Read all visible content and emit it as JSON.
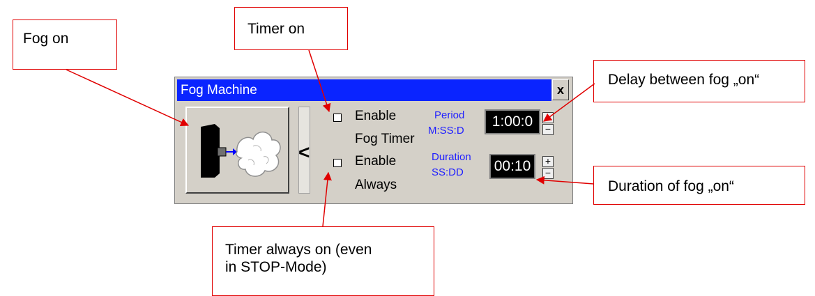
{
  "callouts": {
    "fog_on": "Fog on",
    "timer_on": "Timer on",
    "delay": "Delay between fog „on“",
    "duration": "Duration of fog „on“",
    "always_line1": "Timer always on (even",
    "always_line2": "in STOP-Mode)"
  },
  "window": {
    "title": "Fog Machine",
    "close_label": "x",
    "collapse_label": "<",
    "enable_fog_timer_line1": "Enable",
    "enable_fog_timer_line2": "Fog Timer",
    "enable_always_line1": "Enable",
    "enable_always_line2": "Always",
    "period_label": "Period",
    "period_format": "M:SS:D",
    "period_value": "1:00:0",
    "duration_label": "Duration",
    "duration_format": "SS:DD",
    "duration_value": "00:10",
    "plus": "+",
    "minus": "−"
  },
  "colors": {
    "titlebar": "#0a24ff",
    "arrow": "#e00000",
    "label_blue": "#2020ff"
  }
}
